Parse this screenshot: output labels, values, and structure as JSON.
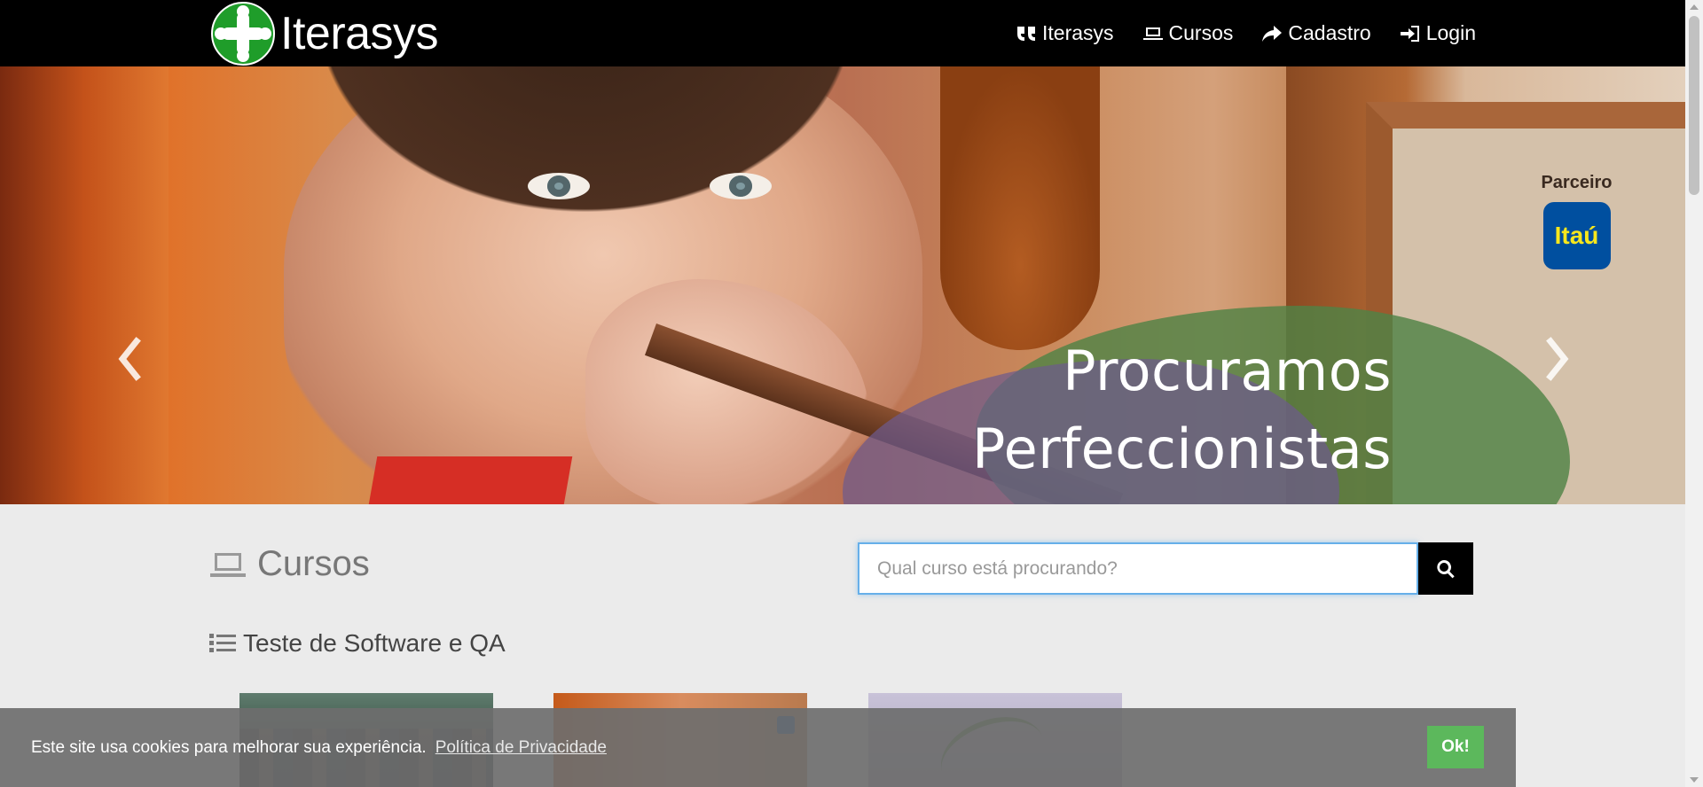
{
  "brand": {
    "name": "Iterasys"
  },
  "nav": {
    "items": [
      {
        "label": "Iterasys",
        "icon": "quote-icon"
      },
      {
        "label": "Cursos",
        "icon": "laptop-icon"
      },
      {
        "label": "Cadastro",
        "icon": "share-icon"
      },
      {
        "label": "Login",
        "icon": "sign-in-icon"
      }
    ]
  },
  "hero": {
    "headline_line1": "Procuramos",
    "headline_line2": "Perfeccionistas",
    "partner_label": "Parceiro",
    "partner_logo_text": "Itaú",
    "slides_count": 2,
    "active_slide": 1
  },
  "courses": {
    "title": "Cursos",
    "search_placeholder": "Qual curso está procurando?",
    "category": "Teste de Software e QA"
  },
  "cookie": {
    "message": "Este site usa cookies para melhorar sua experiência.",
    "policy_link": "Política de Privacidade",
    "ok_label": "Ok!"
  },
  "colors": {
    "navbar_bg": "#000000",
    "brand_green": "#1f9d2a",
    "cookie_ok_green": "#5cb85c",
    "itau_blue": "#004f9f",
    "itau_yellow": "#f8e71c",
    "page_bg": "#ebebeb"
  }
}
